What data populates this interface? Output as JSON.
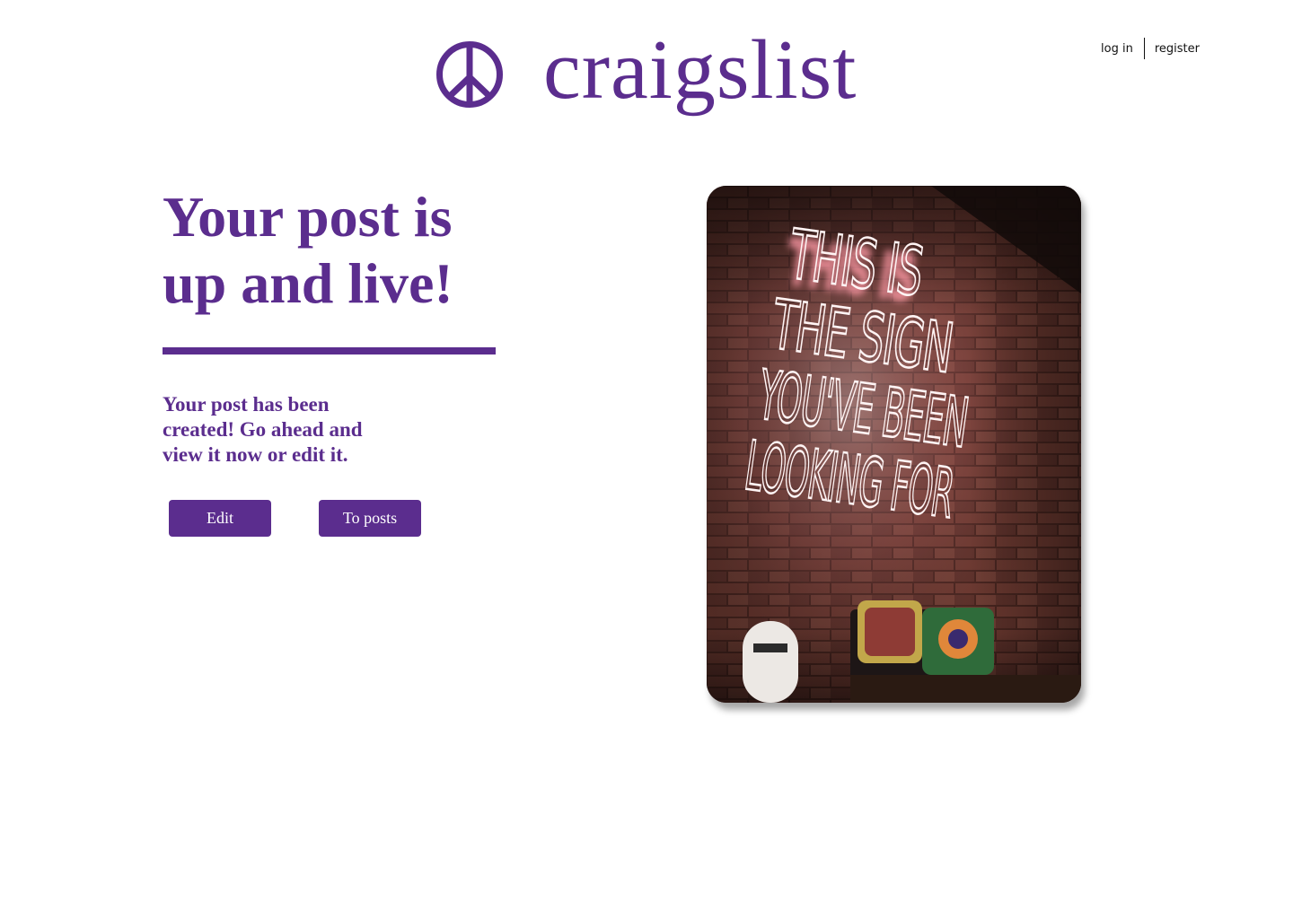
{
  "header": {
    "brand": "craigslist",
    "logo_icon": "peace-icon",
    "login_label": "log in",
    "register_label": "register"
  },
  "main": {
    "headline_line1": "Your post is",
    "headline_line2": "up and live!",
    "message": "Your post has been created! Go ahead and view it now or edit it.",
    "edit_label": "Edit",
    "to_posts_label": "To posts"
  },
  "photo": {
    "sign_lines": [
      "THIS IS",
      "THE SIGN",
      "YOU'VE BEEN",
      "LOOKING FOR"
    ]
  },
  "colors": {
    "accent": "#5B2D8E",
    "text": "#111111",
    "background": "#FFFFFF"
  }
}
